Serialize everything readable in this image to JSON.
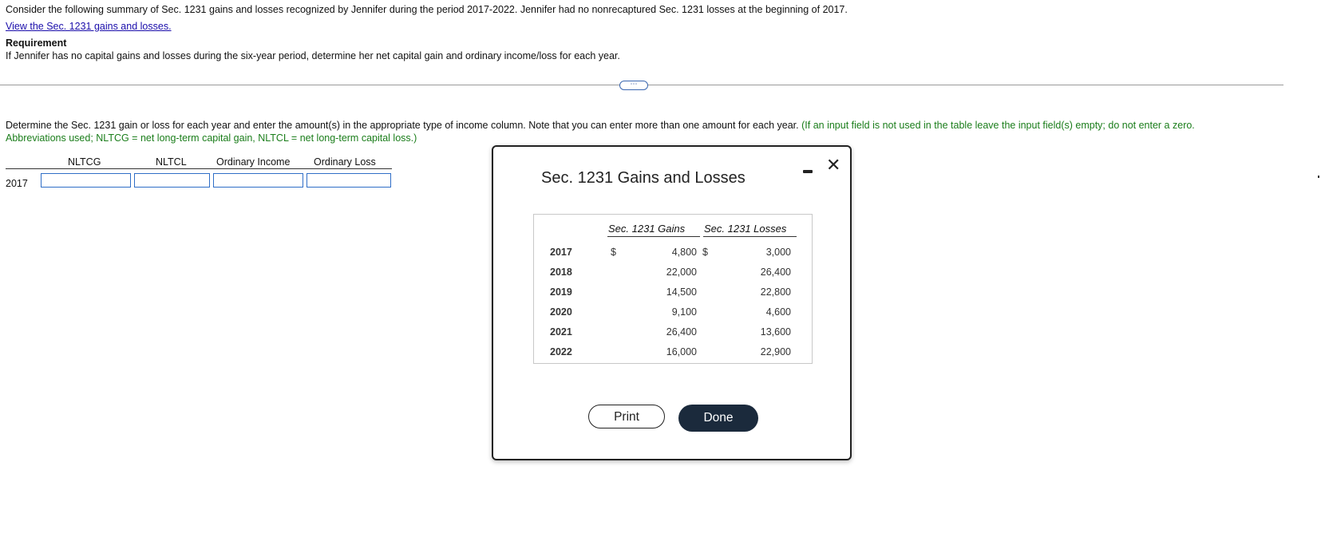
{
  "intro_text": "Consider the following summary of Sec. 1231 gains and losses recognized by Jennifer during the period 2017-2022. Jennifer had no nonrecaptured Sec. 1231 losses at the beginning of 2017.",
  "view_link": "View the Sec. 1231 gains and losses.",
  "requirement": {
    "heading": "Requirement",
    "text": "If Jennifer has no capital gains and losses during the six-year period, determine her net capital gain and ordinary income/loss for each year."
  },
  "more_button": "⋯",
  "instruction": {
    "main": "Determine the Sec. 1231 gain or loss for each year and enter the amount(s) in the appropriate type of income column. Note that you can enter more than one amount for each year.",
    "green_line1": "(If an input field is not used in the table leave the input field(s) empty; do not enter a zero.",
    "green_line2": "Abbreviations used; NLTCG = net long-term capital gain, NLTCL = net long-term capital loss.)"
  },
  "answer_table": {
    "columns": [
      "NLTCG",
      "NLTCL",
      "Ordinary Income",
      "Ordinary Loss"
    ],
    "row_year": "2017",
    "values": [
      "",
      "",
      "",
      ""
    ]
  },
  "modal": {
    "title": "Sec. 1231 Gains and Losses",
    "col_gains": "Sec. 1231 Gains",
    "col_losses": "Sec. 1231 Losses",
    "dollar": "$",
    "rows": [
      {
        "year": "2017",
        "gain": "4,800",
        "loss": "3,000"
      },
      {
        "year": "2018",
        "gain": "22,000",
        "loss": "26,400"
      },
      {
        "year": "2019",
        "gain": "14,500",
        "loss": "22,800"
      },
      {
        "year": "2020",
        "gain": "9,100",
        "loss": "4,600"
      },
      {
        "year": "2021",
        "gain": "26,400",
        "loss": "13,600"
      },
      {
        "year": "2022",
        "gain": "16,000",
        "loss": "22,900"
      }
    ],
    "print_label": "Print",
    "done_label": "Done",
    "close_icon": "✕"
  }
}
